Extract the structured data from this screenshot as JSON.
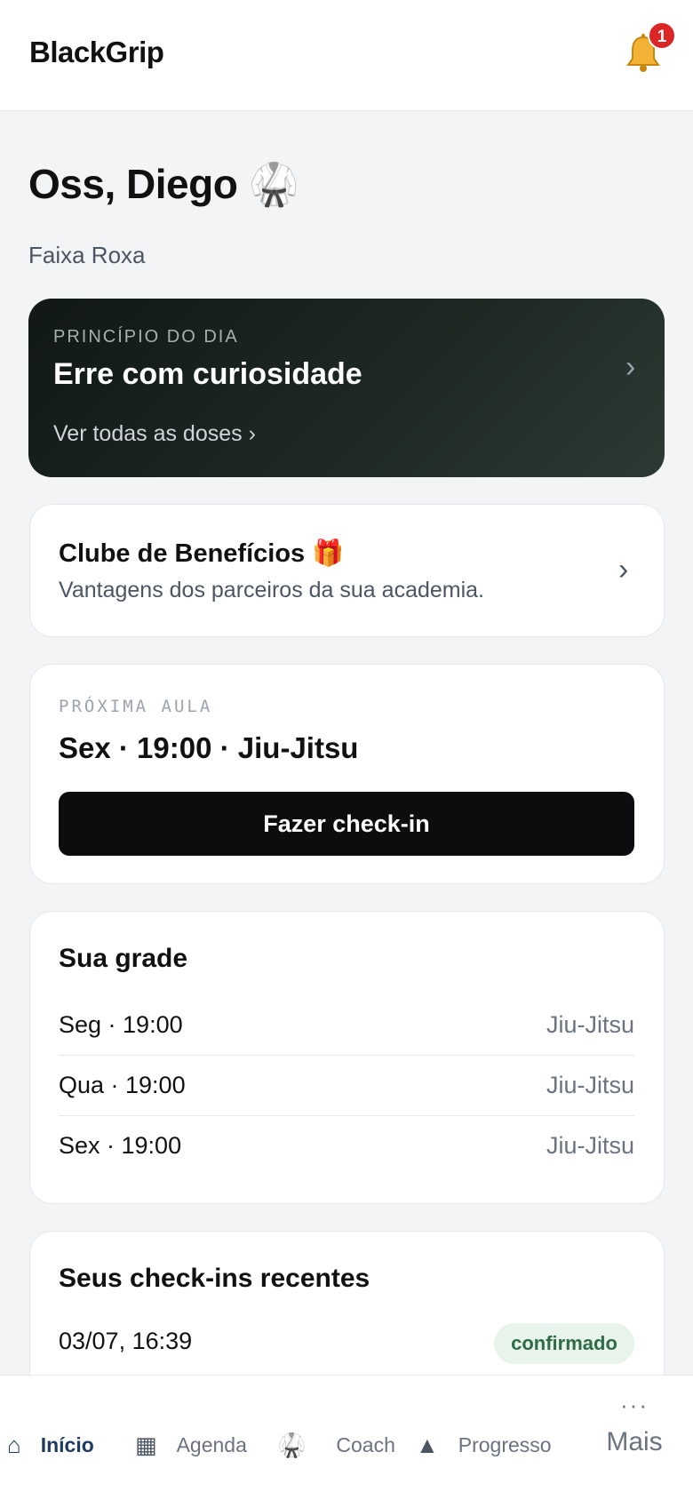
{
  "header": {
    "brand": "BlackGrip",
    "notifications_count": "1"
  },
  "greeting": {
    "title": "Oss, Diego 🥋",
    "belt": "Faixa Roxa"
  },
  "principle": {
    "kicker": "PRINCÍPIO DO DIA",
    "title": "Erre com curiosidade",
    "link": "Ver todas as doses ›"
  },
  "benefits": {
    "title": "Clube de Benefícios 🎁",
    "subtitle": "Vantagens dos parceiros da sua academia."
  },
  "next_class": {
    "kicker": "PRÓXIMA AULA",
    "title": "Sex · 19:00 · Jiu-Jitsu",
    "button": "Fazer check-in"
  },
  "schedule": {
    "title": "Sua grade",
    "rows": [
      {
        "day": "Seg · 19:00",
        "class": "Jiu-Jitsu"
      },
      {
        "day": "Qua · 19:00",
        "class": "Jiu-Jitsu"
      },
      {
        "day": "Sex · 19:00",
        "class": "Jiu-Jitsu"
      }
    ]
  },
  "checkins": {
    "title": "Seus check-ins recentes",
    "items": [
      {
        "time": "03/07, 16:39",
        "status": "confirmado"
      }
    ]
  },
  "tabbar": {
    "items": [
      {
        "label": "Início",
        "icon": "⌂",
        "icon_name": "home-icon",
        "active": true
      },
      {
        "label": "Agenda",
        "icon": "▦",
        "icon_name": "calendar-icon",
        "active": false
      },
      {
        "label": "Coach",
        "icon": "🥋",
        "icon_name": "gi-icon",
        "active": false
      },
      {
        "label": "Progresso",
        "icon": "▲",
        "icon_name": "progress-icon",
        "active": false
      }
    ],
    "more": {
      "dots": "···",
      "label": "Mais"
    }
  },
  "colors": {
    "accent": "#1e3a5f",
    "badge": "#dc2626",
    "success_bg": "#e8f3ec",
    "success_text": "#2f6b45",
    "principle_bg": "#1f2a25"
  }
}
